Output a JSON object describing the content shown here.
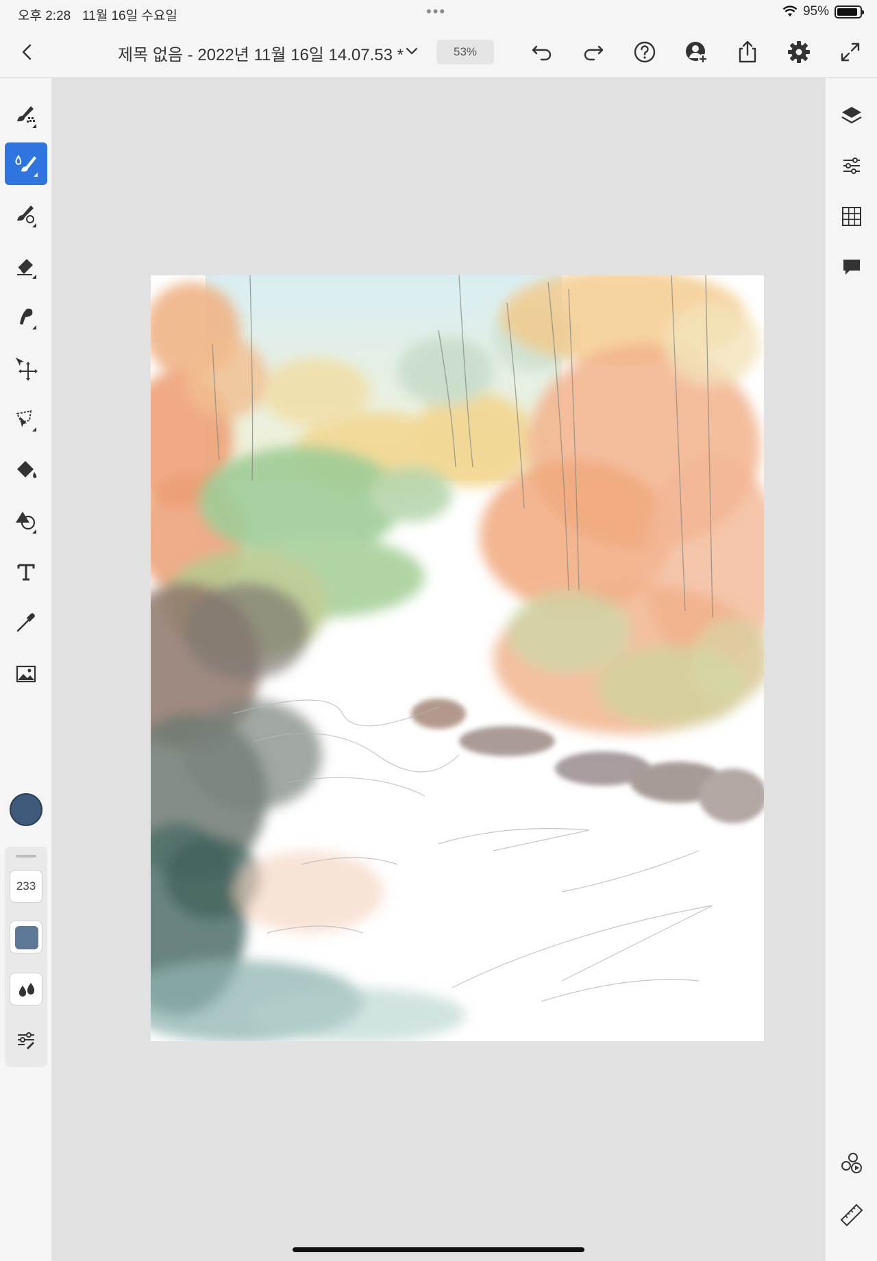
{
  "status_bar": {
    "time": "오후 2:28",
    "date": "11월 16일 수요일",
    "battery": "95%",
    "battery_level": 0.95
  },
  "document": {
    "title": "제목 없음 - 2022년 11월 16일 14.07.53 *",
    "zoom": "53%"
  },
  "top_toolbar": {
    "icons": [
      "back-icon",
      "chevron-down-icon",
      "undo-icon",
      "redo-icon",
      "help-icon",
      "invite-icon",
      "share-icon",
      "settings-icon",
      "fullscreen-icon"
    ]
  },
  "left_toolbar": {
    "tools": [
      "pixel-brush",
      "live-brush",
      "vector-brush",
      "eraser",
      "smudge",
      "transform",
      "selection",
      "fill",
      "shapes",
      "text",
      "eyedropper",
      "image"
    ],
    "active_tool": "live-brush",
    "current_color": "#3f5a78"
  },
  "brush_panel": {
    "size": "233",
    "opacity_color": "#5d7896"
  },
  "right_toolbar": {
    "icons": [
      "layers-icon",
      "adjustments-icon",
      "grid-icon",
      "comment-icon",
      "livestream-icon",
      "ruler-icon"
    ]
  },
  "canvas": {
    "subject": "watercolor forest path"
  },
  "colors": {
    "accent": "#2f74df",
    "panel_bg": "#f5f5f5",
    "workspace_bg": "#e1e1e1"
  }
}
